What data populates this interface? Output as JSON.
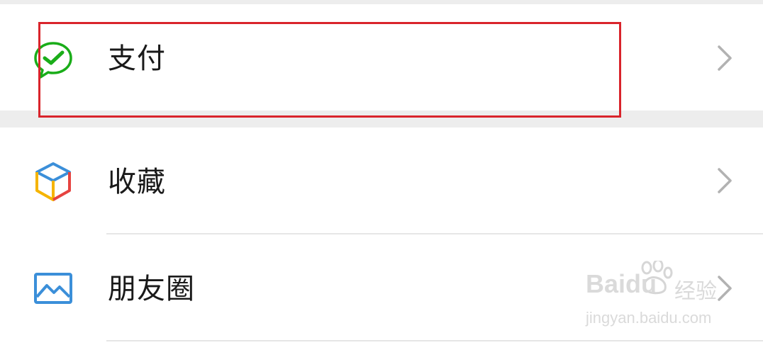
{
  "menu": {
    "items": [
      {
        "label": "支付",
        "icon": "wechat-pay-icon"
      },
      {
        "label": "收藏",
        "icon": "favorites-cube-icon"
      },
      {
        "label": "朋友圈",
        "icon": "moments-photo-icon"
      }
    ]
  },
  "watermark": {
    "brand": "Baidu",
    "brand_cn": "经验",
    "url": "jingyan.baidu.com"
  },
  "colors": {
    "separator": "#ededed",
    "highlight": "#d9242b",
    "pay_green": "#1aad19",
    "moments_blue": "#3b8fd9",
    "chevron": "#b2b2b2"
  }
}
